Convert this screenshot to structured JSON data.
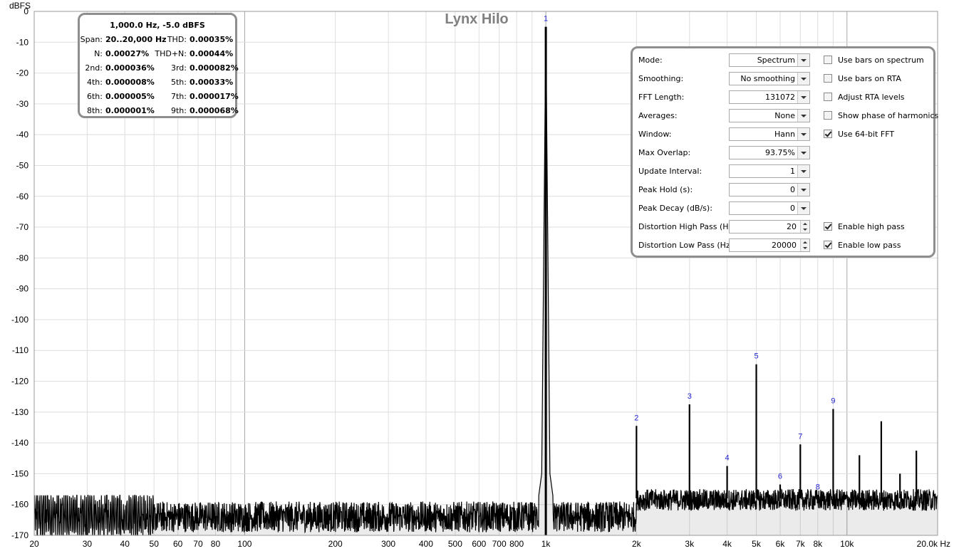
{
  "chart_data": {
    "type": "line",
    "title": "Lynx Hilo",
    "ylabel": "dBFS",
    "xunit": "Hz",
    "xscale": "log",
    "xlim": [
      20,
      20000
    ],
    "ylim": [
      -170,
      0
    ],
    "grid": true,
    "yticks": [
      0,
      -10,
      -20,
      -30,
      -40,
      -50,
      -60,
      -70,
      -80,
      -90,
      -100,
      -110,
      -120,
      -130,
      -140,
      -150,
      -160,
      -170
    ],
    "ytick_labels": [
      "0",
      "-10",
      "-20",
      "-30",
      "-40",
      "-50",
      "-60",
      "-70",
      "-80",
      "-90",
      "-100",
      "-110",
      "-120",
      "-130",
      "-140",
      "-150",
      "-160",
      "-170"
    ],
    "xticks": [
      20,
      30,
      40,
      50,
      60,
      70,
      80,
      100,
      200,
      300,
      400,
      500,
      600,
      700,
      800,
      1000,
      2000,
      3000,
      4000,
      5000,
      6000,
      7000,
      8000,
      10000,
      20000
    ],
    "xtick_labels": [
      "20",
      "30",
      "40",
      "50",
      "60",
      "70",
      "80",
      "100",
      "200",
      "300",
      "400",
      "500",
      "600",
      "700",
      "800",
      "1k",
      "2k",
      "3k",
      "4k",
      "5k",
      "6k",
      "7k",
      "8k",
      "10k",
      "20.0k Hz"
    ],
    "harmonics": [
      {
        "label": "1",
        "freq": 1000,
        "level": -5.0
      },
      {
        "label": "2",
        "freq": 2000,
        "level": -134.5
      },
      {
        "label": "3",
        "freq": 3000,
        "level": -127.5
      },
      {
        "label": "4",
        "freq": 4000,
        "level": -147.5
      },
      {
        "label": "5",
        "freq": 5000,
        "level": -114.5
      },
      {
        "label": "6",
        "freq": 6000,
        "level": -153.5
      },
      {
        "label": "7",
        "freq": 7000,
        "level": -140.5
      },
      {
        "label": "8",
        "freq": 8000,
        "level": -157.0
      },
      {
        "label": "9",
        "freq": 9000,
        "level": -129.0
      }
    ],
    "spurs": [
      {
        "freq": 11000,
        "level": -144
      },
      {
        "freq": 13000,
        "level": -133
      },
      {
        "freq": 15000,
        "level": -150
      },
      {
        "freq": 17000,
        "level": -142.5
      }
    ],
    "noise_floor": {
      "low_band_freq": [
        20,
        50
      ],
      "low_band_level": [
        -170,
        -157
      ],
      "mid_level": [
        -169,
        -159
      ],
      "high_level": [
        -162,
        -155
      ]
    }
  },
  "stats": {
    "header": "1,000.0 Hz, -5.0 dBFS",
    "rows": [
      {
        "l1": "Span:",
        "v1": "20..20,000 Hz",
        "l2": "THD:",
        "v2": "0.00035%"
      },
      {
        "l1": "N:",
        "v1": "0.00027%",
        "l2": "THD+N:",
        "v2": "0.00044%"
      },
      {
        "l1": "2nd:",
        "v1": "0.000036%",
        "l2": "3rd:",
        "v2": "0.000082%"
      },
      {
        "l1": "4th:",
        "v1": "0.000008%",
        "l2": "5th:",
        "v2": "0.00033%"
      },
      {
        "l1": "6th:",
        "v1": "0.000005%",
        "l2": "7th:",
        "v2": "0.000017%"
      },
      {
        "l1": "8th:",
        "v1": "0.000001%",
        "l2": "9th:",
        "v2": "0.000068%"
      }
    ]
  },
  "controls": {
    "rows": [
      {
        "label": "Mode:",
        "value": "Spectrum",
        "kind": "combo",
        "check_label": "Use bars on spectrum",
        "checked": false
      },
      {
        "label": "Smoothing:",
        "value": "No  smoothing",
        "kind": "combo",
        "check_label": "Use bars on RTA",
        "checked": false
      },
      {
        "label": "FFT Length:",
        "value": "131072",
        "kind": "combo",
        "check_label": "Adjust RTA levels",
        "checked": false
      },
      {
        "label": "Averages:",
        "value": "None",
        "kind": "combo",
        "check_label": "Show phase of harmonics",
        "checked": false
      },
      {
        "label": "Window:",
        "value": "Hann",
        "kind": "combo",
        "check_label": "Use 64-bit FFT",
        "checked": true
      },
      {
        "label": "Max Overlap:",
        "value": "93.75%",
        "kind": "combo",
        "check_label": "",
        "checked": false
      },
      {
        "label": "Update Interval:",
        "value": "1",
        "kind": "combo",
        "check_label": "",
        "checked": false
      },
      {
        "label": "Peak Hold (s):",
        "value": "0",
        "kind": "combo",
        "check_label": "",
        "checked": false
      },
      {
        "label": "Peak Decay (dB/s):",
        "value": "0",
        "kind": "combo",
        "check_label": "",
        "checked": false
      },
      {
        "label": "Distortion High Pass (Hz):",
        "value": "20",
        "kind": "spin",
        "check_label": "Enable high pass",
        "checked": true
      },
      {
        "label": "Distortion Low Pass (Hz):",
        "value": "20000",
        "kind": "spin",
        "check_label": "Enable low pass",
        "checked": true
      }
    ]
  },
  "colors": {
    "trace": "#000000",
    "grid": "#dedede",
    "decade_grid": "#a6a6a6",
    "marker": "#1f1fd0",
    "title": "#808080"
  }
}
